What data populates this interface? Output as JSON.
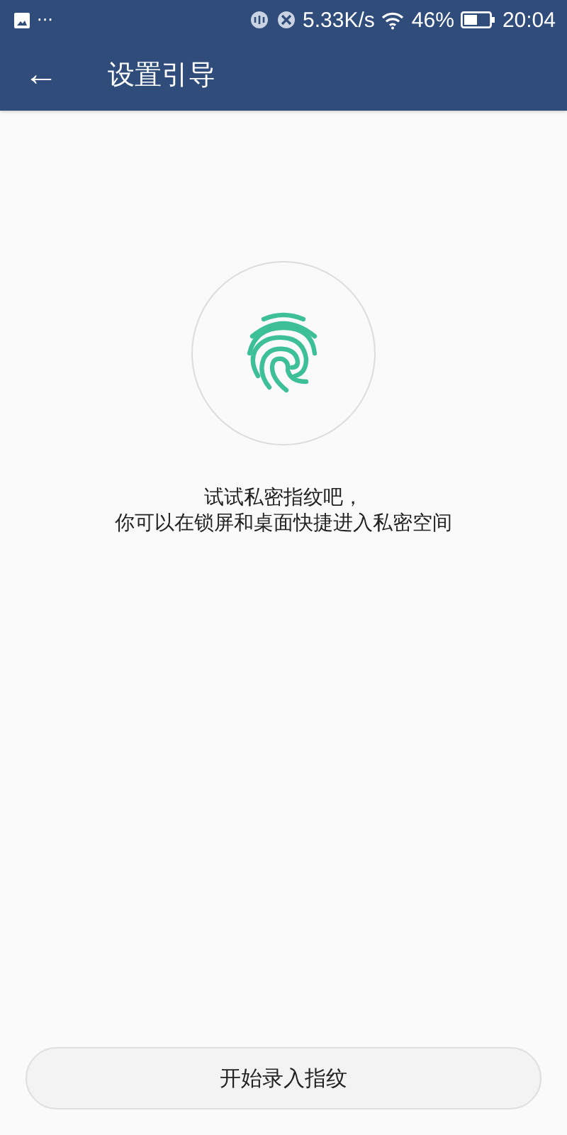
{
  "status_bar": {
    "more": "···",
    "speed": "5.33K/s",
    "battery": "46%",
    "time": "20:04"
  },
  "app_bar": {
    "back": "←",
    "title": "设置引导"
  },
  "message_lines": [
    "试试私密指纹吧，",
    "你可以在锁屏和桌面快捷进入私密空间"
  ],
  "button": "开始录入指纹"
}
